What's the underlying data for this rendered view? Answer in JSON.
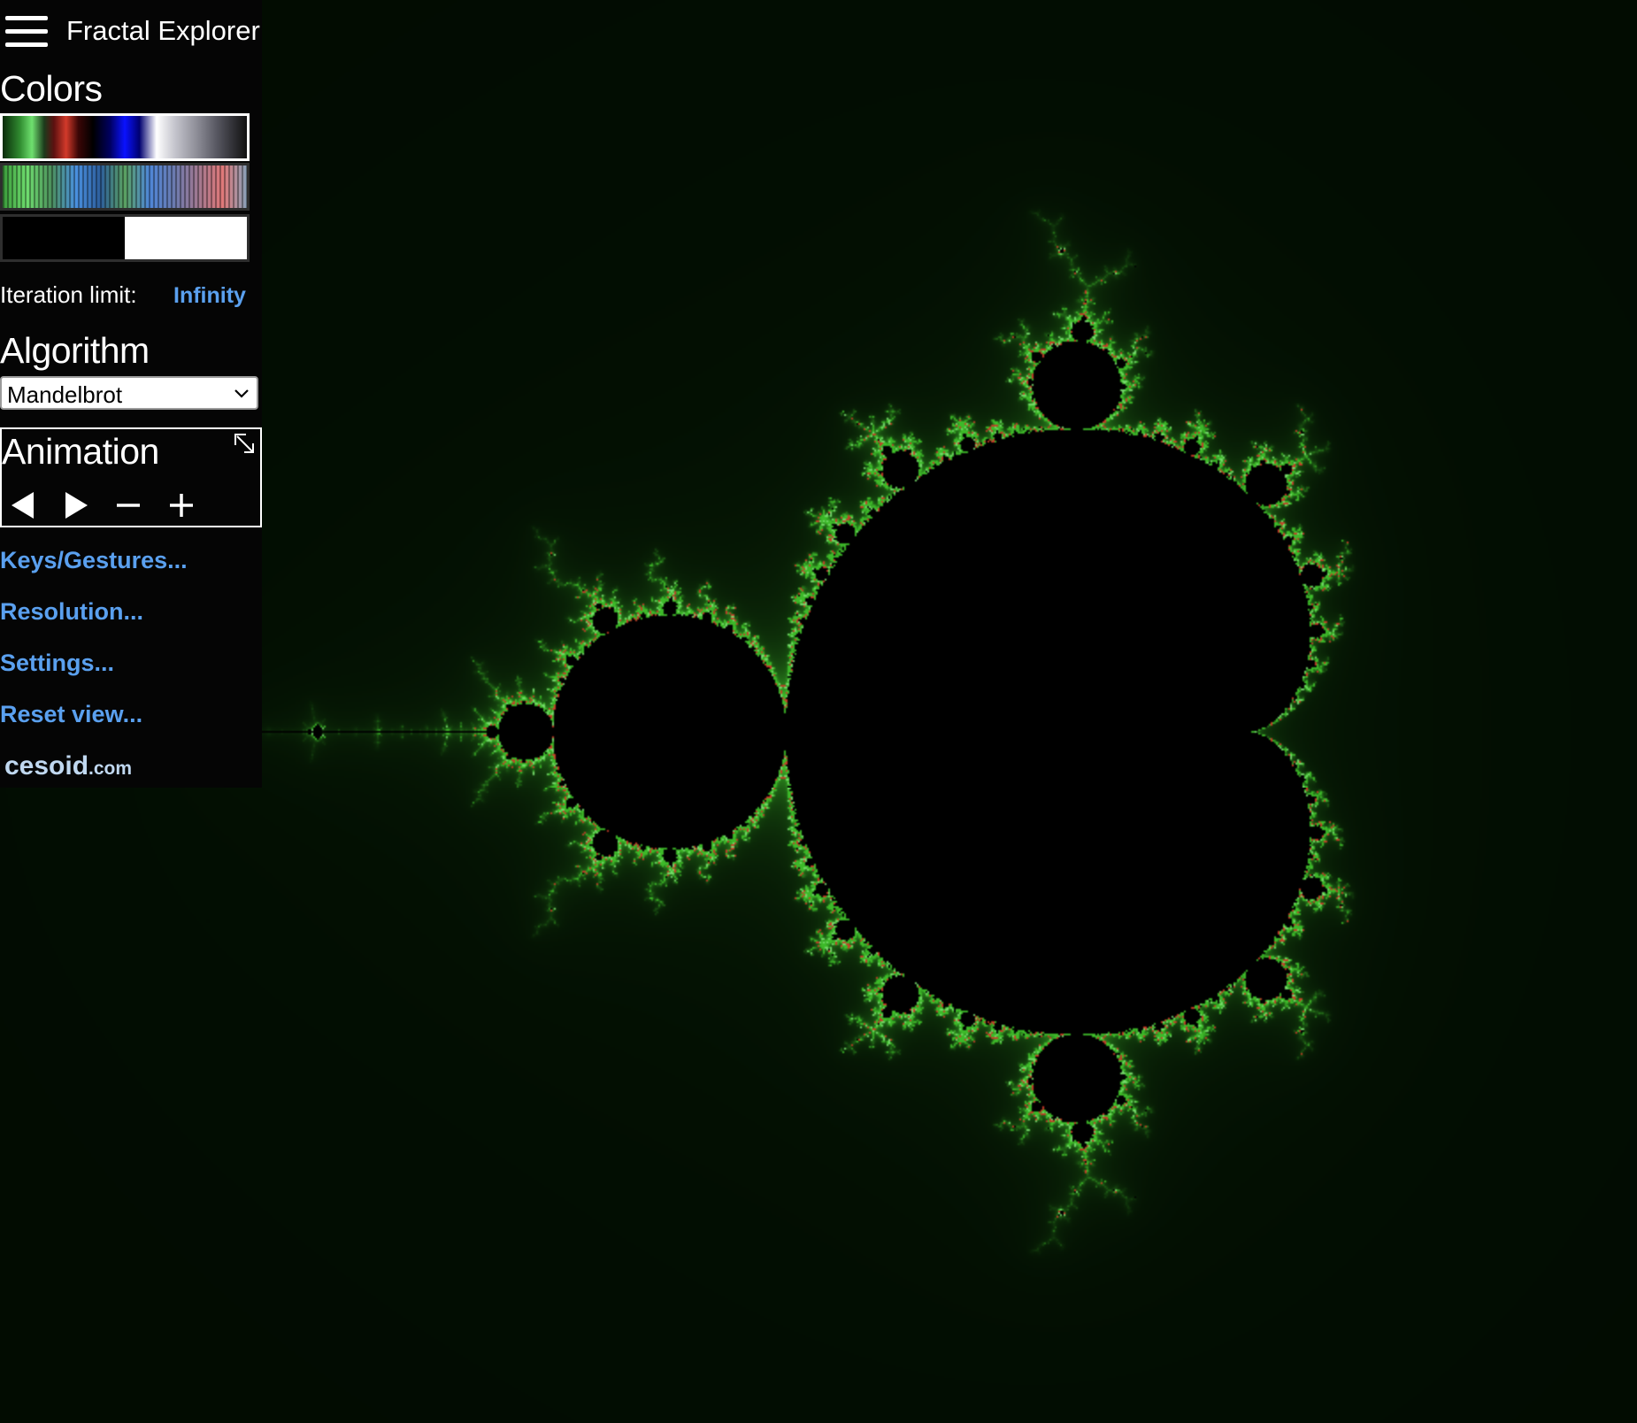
{
  "header": {
    "title": "Fractal Explorer",
    "menu_icon": "hamburger-menu-icon"
  },
  "colors": {
    "heading": "Colors",
    "palettes": [
      {
        "name": "palette-rainbow",
        "selected": true
      },
      {
        "name": "palette-striped",
        "selected": false
      },
      {
        "name": "palette-black-white",
        "selected": false
      }
    ]
  },
  "iteration": {
    "label": "Iteration limit:",
    "value": "Infinity"
  },
  "algorithm": {
    "heading": "Algorithm",
    "selected": "Mandelbrot"
  },
  "animation": {
    "heading": "Animation",
    "expand_icon": "expand-arrow-icon",
    "controls": [
      "play-backward-icon",
      "play-forward-icon",
      "slower-minus-icon",
      "faster-plus-icon"
    ]
  },
  "links": {
    "keys": "Keys/Gestures...",
    "resolution": "Resolution...",
    "settings": "Settings...",
    "reset": "Reset view..."
  },
  "brand": {
    "name": "cesoid",
    "suffix": ".com"
  },
  "theme": {
    "link_color": "#5aa0ef",
    "sidebar_bg": "#050505",
    "fractal_edge": "#3e9a2e",
    "fractal_background": "#010a01"
  },
  "fractal": {
    "type": "Mandelbrot",
    "center": [
      -0.5,
      0.0
    ]
  }
}
